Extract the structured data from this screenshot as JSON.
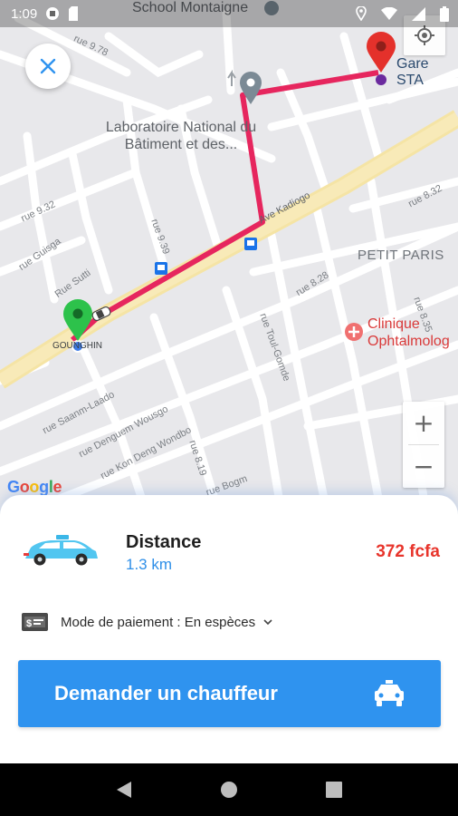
{
  "status_bar": {
    "time": "1:09"
  },
  "map": {
    "poi_school": "School Montaigne",
    "poi_lab_line1": "Laboratoire National du",
    "poi_lab_line2": "Bâtiment et des...",
    "gare": "Gare STA",
    "district": "PETIT PARIS",
    "clinic_line1": "Clinique",
    "clinic_line2": "Ophtalmolog",
    "origin_label": "GOUNGHIN",
    "google": "Google",
    "streets": [
      "rue 9.78",
      "rue 9.32",
      "rue Guisga",
      "Rue Sutti",
      "rue 9.39",
      "Ave Kadiogo",
      "rue 8.32",
      "rue 8.28",
      "rue 8.35",
      "rue Toul-Gomde",
      "rue Saanm-Laado",
      "rue Denguem Wousgo",
      "rue Kon Deng Wondbo",
      "rue 8.19",
      "rue Bogm"
    ],
    "zoom_in": "+",
    "zoom_out": "−",
    "colors": {
      "route": "#e6265e",
      "origin_pin": "#2dc24b",
      "dest_pin": "#e4312b",
      "waypoint_pin": "#7b8a95"
    }
  },
  "sheet": {
    "distance_title": "Distance",
    "distance_value": "1.3 km",
    "price": "372 fcfa",
    "payment_label": "Mode de paiement : En espèces",
    "request_button": "Demander un chauffeur",
    "colors": {
      "accent": "#2f93ef",
      "price": "#e8352c"
    }
  }
}
